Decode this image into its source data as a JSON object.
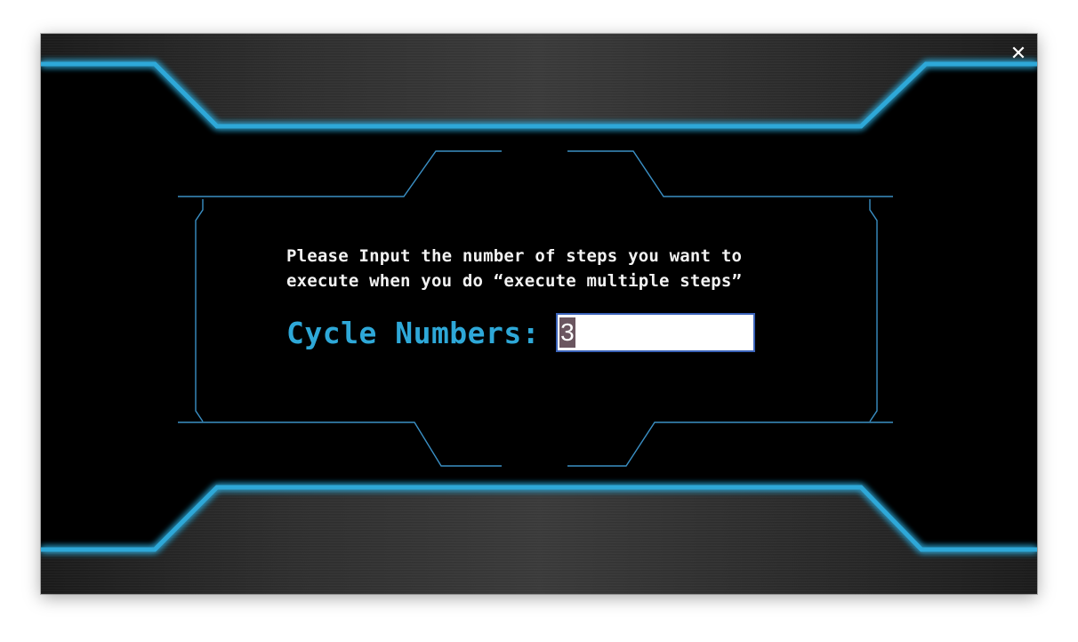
{
  "window": {
    "close_glyph": "✕"
  },
  "dialog": {
    "message": "Please Input the number of steps you want to\nexecute when you do “execute multiple steps”",
    "field_label": "Cycle Numbers:",
    "field_value": "3"
  },
  "colors": {
    "background": "#000000",
    "accent_glow": "#2ea8d8",
    "frame_line": "#3a8fc4",
    "message_text": "#f2f2f2",
    "input_border": "#3a62b8",
    "selection": "#6b5660"
  }
}
